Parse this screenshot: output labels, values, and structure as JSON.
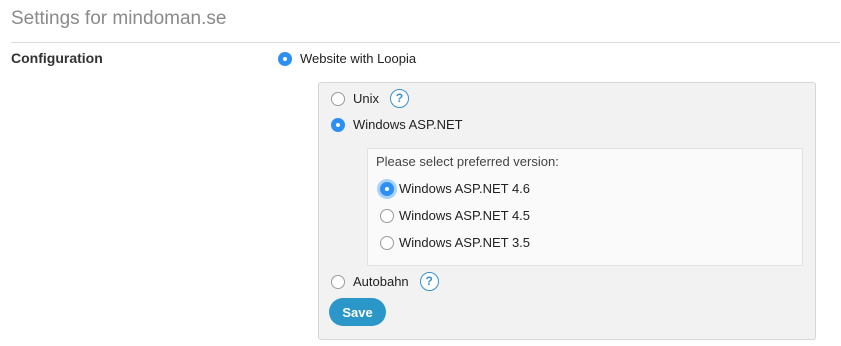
{
  "page": {
    "title": "Settings for mindoman.se"
  },
  "configuration": {
    "label": "Configuration",
    "main_option": {
      "label": "Website with Loopia",
      "selected": true
    },
    "options": [
      {
        "label": "Unix",
        "selected": false,
        "help": "?"
      },
      {
        "label": "Windows ASP.NET",
        "selected": true
      },
      {
        "label": "Autobahn",
        "selected": false,
        "help": "?"
      }
    ],
    "version": {
      "prompt": "Please select preferred version:",
      "options": [
        {
          "label": "Windows ASP.NET 4.6",
          "selected": true
        },
        {
          "label": "Windows ASP.NET 4.5",
          "selected": false
        },
        {
          "label": "Windows ASP.NET 3.5",
          "selected": false
        }
      ]
    },
    "save_label": "Save"
  },
  "colors": {
    "accent": "#2d8ff3",
    "save_button": "#2a97c8",
    "help_icon": "#3a8fcf",
    "title_text": "#8a8a8a"
  }
}
